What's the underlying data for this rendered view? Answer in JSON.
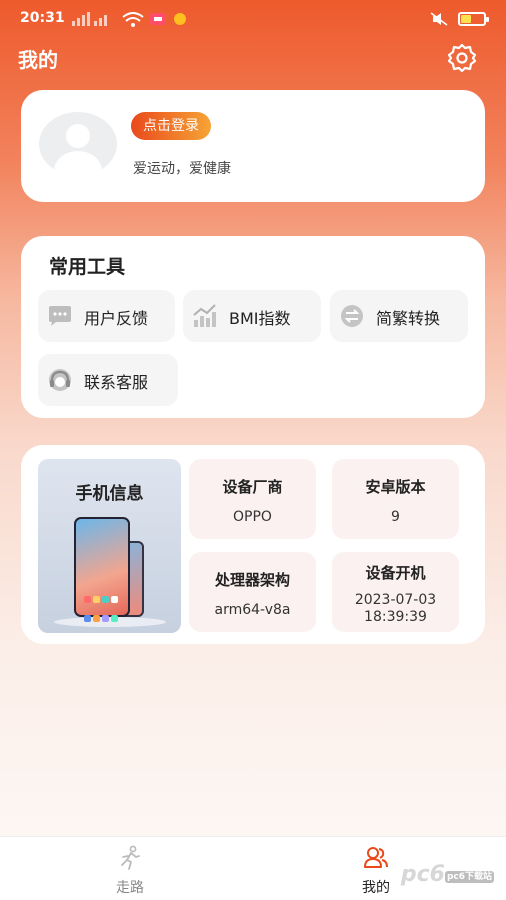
{
  "status_bar": {
    "time": "20:31"
  },
  "header": {
    "title": "我的"
  },
  "profile": {
    "login_label": "点击登录",
    "motto": "爱运动，爱健康"
  },
  "tools": {
    "title": "常用工具",
    "items": [
      {
        "label": "用户反馈",
        "icon": "chat-icon"
      },
      {
        "label": "BMI指数",
        "icon": "chart-icon"
      },
      {
        "label": "简繁转换",
        "icon": "convert-icon"
      },
      {
        "label": "联系客服",
        "icon": "headset-icon"
      }
    ]
  },
  "phone_info": {
    "banner_title": "手机信息",
    "items": [
      {
        "label": "设备厂商",
        "value": "OPPO"
      },
      {
        "label": "安卓版本",
        "value": "9"
      },
      {
        "label": "处理器架构",
        "value": "arm64-v8a"
      },
      {
        "label": "设备开机",
        "value_date": "2023-07-03",
        "value_time": "18:39:39"
      }
    ]
  },
  "tabbar": {
    "items": [
      {
        "label": "走路",
        "icon": "walk-icon",
        "active": false
      },
      {
        "label": "我的",
        "icon": "users-icon",
        "active": true
      }
    ]
  },
  "watermark": {
    "text": "pc6",
    "badge": "pc6下载站"
  },
  "colors": {
    "accent": "#ee5a2c",
    "accent_light": "#f6a436",
    "active_tab": "#e94a1c"
  }
}
